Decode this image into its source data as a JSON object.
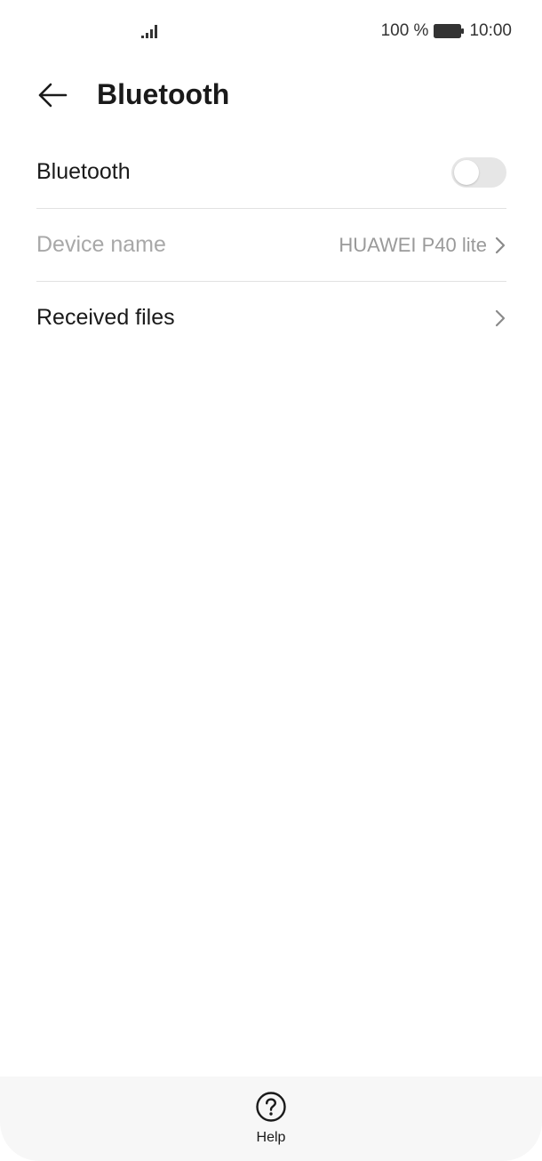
{
  "status_bar": {
    "battery_text": "100 %",
    "time": "10:00",
    "signal_icon": "signal-icon",
    "battery_icon": "battery-icon"
  },
  "header": {
    "title": "Bluetooth",
    "back_icon": "back-arrow-icon"
  },
  "settings": {
    "bluetooth": {
      "label": "Bluetooth",
      "enabled": false
    },
    "device_name": {
      "label": "Device name",
      "value": "HUAWEI P40 lite",
      "disabled": true
    },
    "received_files": {
      "label": "Received files"
    }
  },
  "bottom_bar": {
    "help_label": "Help",
    "help_icon": "help-icon"
  },
  "colors": {
    "background": "#ffffff",
    "text_primary": "#1a1a1a",
    "text_disabled": "#a8a8a8",
    "toggle_off": "#e6e6e6",
    "bottom_bar": "#f7f7f7"
  }
}
